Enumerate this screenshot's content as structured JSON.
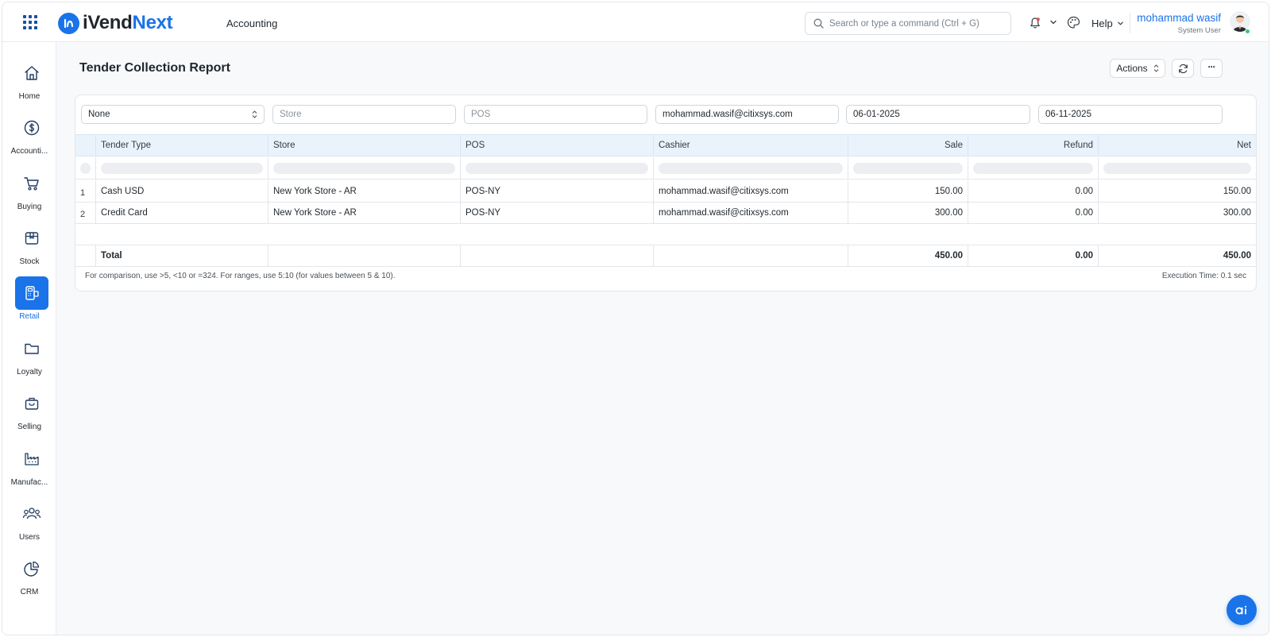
{
  "header": {
    "logo_prefix": "i",
    "logo_main": "Vend",
    "logo_accent": "Next",
    "module": "Accounting",
    "search_placeholder": "Search or type a command (Ctrl + G)",
    "help_label": "Help",
    "user_name": "mohammad wasif",
    "user_role": "System User"
  },
  "sidebar": {
    "items": [
      {
        "label": "Home",
        "icon": "home-icon"
      },
      {
        "label": "Accounti...",
        "icon": "dollar-circle-icon"
      },
      {
        "label": "Buying",
        "icon": "cart-icon"
      },
      {
        "label": "Stock",
        "icon": "box-icon"
      },
      {
        "label": "Retail",
        "icon": "pos-terminal-icon",
        "active": true
      },
      {
        "label": "Loyalty",
        "icon": "folder-icon"
      },
      {
        "label": "Selling",
        "icon": "shopping-bag-icon"
      },
      {
        "label": "Manufac...",
        "icon": "factory-icon"
      },
      {
        "label": "Users",
        "icon": "users-icon"
      },
      {
        "label": "CRM",
        "icon": "pie-chart-icon"
      }
    ]
  },
  "page": {
    "title": "Tender Collection Report",
    "actions_label": "Actions",
    "more_label": "···"
  },
  "filters": {
    "group_by": "None",
    "store_placeholder": "Store",
    "pos_placeholder": "POS",
    "cashier": "mohammad.wasif@citixsys.com",
    "from_date": "06-01-2025",
    "to_date": "06-11-2025"
  },
  "table": {
    "columns": [
      "Tender Type",
      "Store",
      "POS",
      "Cashier",
      "Sale",
      "Refund",
      "Net"
    ],
    "rows": [
      {
        "no": "1",
        "tender_type": "Cash USD",
        "store": "New York Store - AR",
        "pos": "POS-NY",
        "cashier": "mohammad.wasif@citixsys.com",
        "sale": "150.00",
        "refund": "0.00",
        "net": "150.00"
      },
      {
        "no": "2",
        "tender_type": "Credit Card",
        "store": "New York Store - AR",
        "pos": "POS-NY",
        "cashier": "mohammad.wasif@citixsys.com",
        "sale": "300.00",
        "refund": "0.00",
        "net": "300.00"
      }
    ],
    "total": {
      "label": "Total",
      "sale": "450.00",
      "refund": "0.00",
      "net": "450.00"
    }
  },
  "footer": {
    "hint": "For comparison, use >5, <10 or =324. For ranges, use 5:10 (for values between 5 & 10).",
    "execution_time": "Execution Time: 0.1 sec"
  },
  "colors": {
    "brand": "#1a73e8",
    "header_row": "#eaf3fc",
    "online": "#2ecc71"
  }
}
